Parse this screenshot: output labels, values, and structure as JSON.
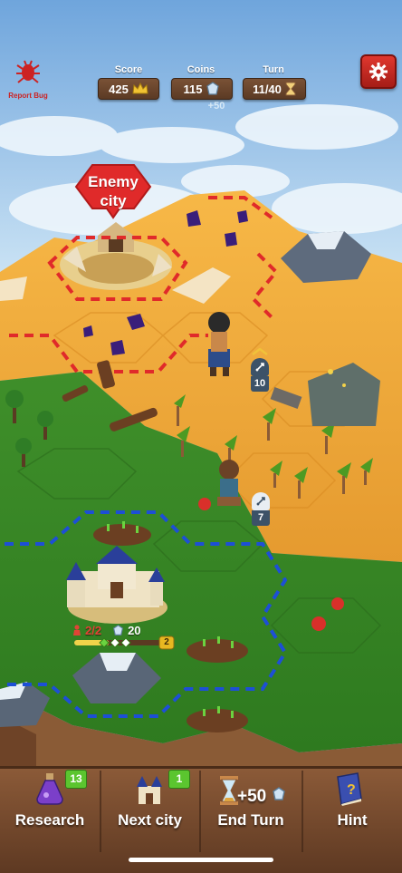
{
  "hud": {
    "report_bug": "Report Bug",
    "score_label": "Score",
    "score_value": "425",
    "coins_label": "Coins",
    "coins_value": "115",
    "coins_income": "+50",
    "turn_label": "Turn",
    "turn_value": "11/40"
  },
  "map": {
    "enemy_city_line1": "Enemy",
    "enemy_city_line2": "city",
    "enemy_unit_hp": "10",
    "player_unit_hp": "7"
  },
  "city": {
    "population": "2/2",
    "income": "20",
    "level": "2",
    "level_progress": 0.4
  },
  "bottom": {
    "research_label": "Research",
    "research_count": "13",
    "next_city_label": "Next city",
    "next_city_count": "1",
    "end_turn_label": "End Turn",
    "end_turn_reward": "+50",
    "hint_label": "Hint"
  },
  "icons": {
    "report_bug": "bug-icon",
    "settings": "gear-icon",
    "score": "crown-icon",
    "coins": "star-coin-icon",
    "turn": "hourglass-icon",
    "research": "potion-icon",
    "next_city": "castle-icon",
    "end_turn": "hourglass-icon",
    "hint": "book-icon"
  },
  "colors": {
    "enemy_border": "#e02a2a",
    "player_border": "#1d4fd6",
    "badge_green": "#5bc52f",
    "settings_red": "#d22d25"
  }
}
